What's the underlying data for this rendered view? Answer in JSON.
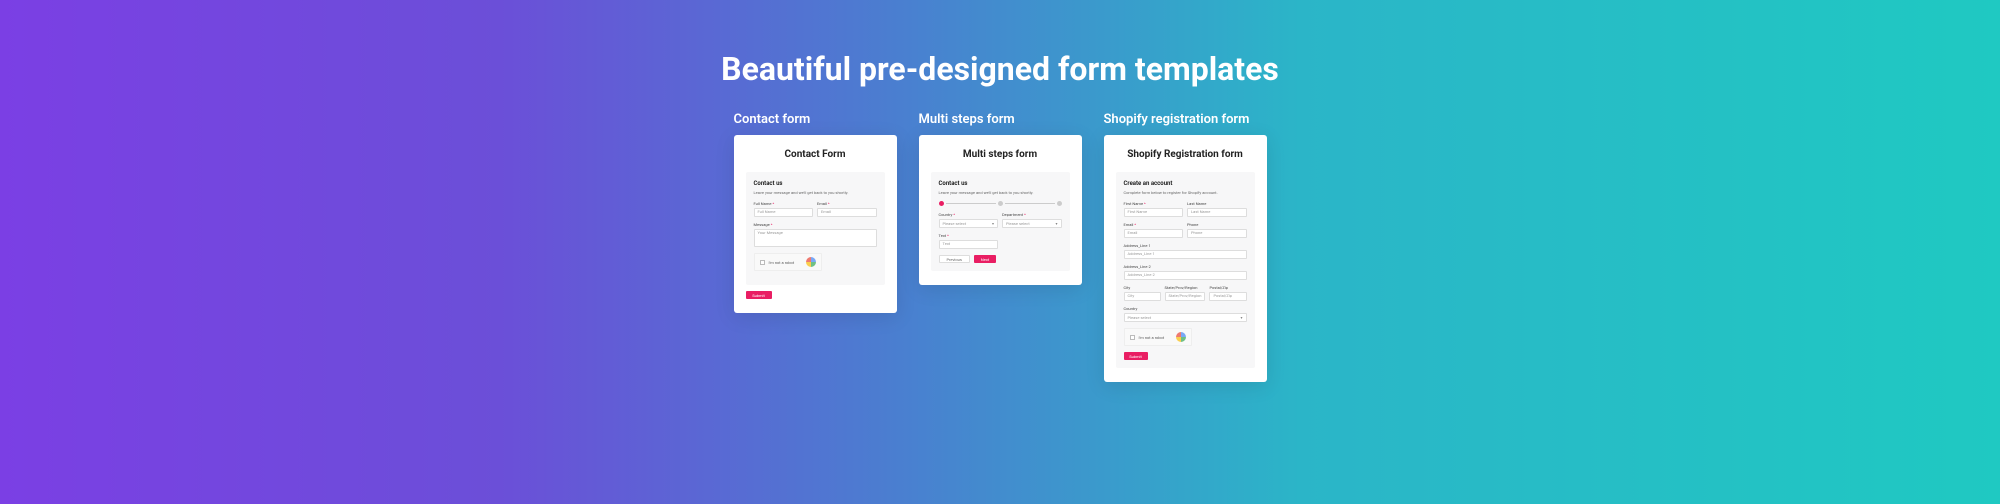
{
  "heading": "Beautiful pre-designed form templates",
  "cards": {
    "contact": {
      "label": "Contact form",
      "title": "Contact Form",
      "panel_head": "Contact us",
      "panel_sub": "Leave your message and we'll get back to you shortly.",
      "full_name_label": "Full Name",
      "full_name_ph": "Full Name",
      "email_label": "Email",
      "email_ph": "Email",
      "message_label": "Message",
      "message_ph": "Your Message",
      "captcha": "I'm not a robot",
      "submit": "Submit"
    },
    "multi": {
      "label": "Multi steps form",
      "title": "Multi steps form",
      "panel_head": "Contact us",
      "panel_sub": "Leave your message and we'll get back to you shortly.",
      "country_label": "Country",
      "country_ph": "Please select",
      "dept_label": "Department",
      "dept_ph": "Please select",
      "text_label": "Text",
      "text_ph": "Text",
      "prev": "Previous",
      "next": "Next"
    },
    "shopify": {
      "label": "Shopify registration form",
      "title": "Shopify Registration form",
      "panel_head": "Create an account",
      "panel_sub": "Complete form below to register for Shopify account.",
      "first_label": "First Name",
      "first_ph": "First Name",
      "last_label": "Last Name",
      "last_ph": "Last Name",
      "email_label": "Email",
      "email_ph": "Email",
      "phone_label": "Phone",
      "phone_ph": "Phone",
      "addr1_label": "Address_Line 1",
      "addr1_ph": "Address_Line 1",
      "addr2_label": "Address_Line 2",
      "addr2_ph": "Address_Line 2",
      "city_label": "City",
      "city_ph": "City",
      "state_label": "State/Prov/Region",
      "state_ph": "State/Prov/Region",
      "postal_label": "Postal/Zip",
      "postal_ph": "Postal/Zip",
      "country_label": "Country",
      "country_ph": "Please select",
      "captcha": "I'm not a robot",
      "submit": "Submit"
    }
  }
}
